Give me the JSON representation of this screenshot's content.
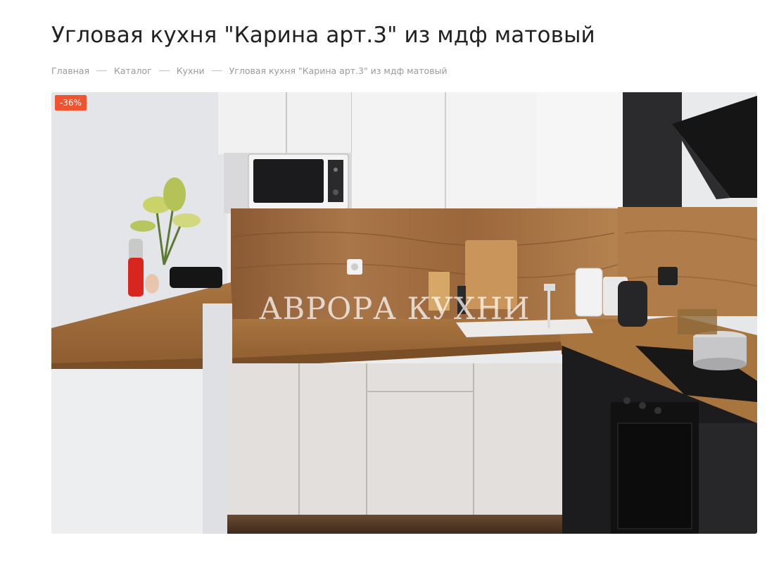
{
  "product": {
    "title": "Угловая кухня \"Карина арт.3\" из мдф матовый",
    "discount_badge": "-36%"
  },
  "breadcrumb": {
    "items": [
      "Главная",
      "Каталог",
      "Кухни",
      "Угловая кухня \"Карина арт.3\" из мдф матовый"
    ]
  },
  "gallery": {
    "watermark": "АВРОРА КУХНИ"
  }
}
